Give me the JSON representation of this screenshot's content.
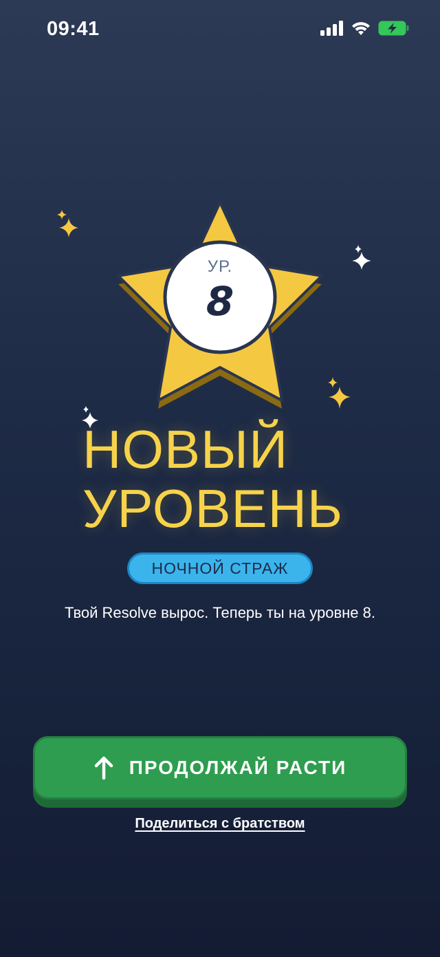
{
  "status_bar": {
    "time": "09:41",
    "icons": [
      "signal-icon",
      "wifi-icon",
      "battery-charging-icon"
    ],
    "battery_color": "#34c759"
  },
  "level": {
    "prefix": "УР.",
    "number": "8",
    "star_color": "#f5c842"
  },
  "title": {
    "line1": "НОВЫЙ",
    "line2": "УРОВЕНЬ",
    "color": "#f7d34a"
  },
  "badge": {
    "label": "НОЧНОЙ СТРАЖ",
    "color": "#3bb4ec"
  },
  "subtitle": "Твой Resolve вырос. Теперь ты на уровне 8.",
  "primary_button": {
    "icon": "arrow-up-icon",
    "label": "ПРОДОЛЖАЙ РАСТИ",
    "color": "#2e9d4f"
  },
  "share_link": "Поделиться с братством"
}
